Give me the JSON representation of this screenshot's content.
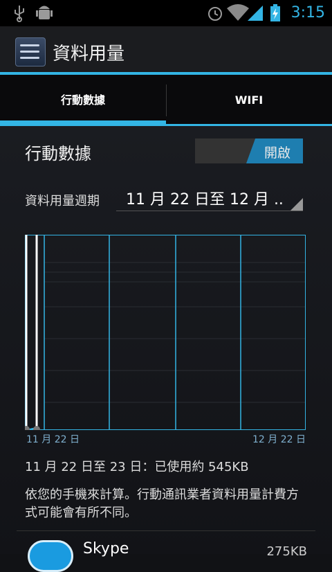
{
  "status_bar": {
    "time": "3:15",
    "icons": [
      "usb-icon",
      "android-debug-icon",
      "alarm-icon",
      "wifi-icon",
      "signal-icon",
      "battery-charging-icon"
    ]
  },
  "action_bar": {
    "title": "資料用量",
    "app_icon": "settings-sliders-icon"
  },
  "tabs": [
    {
      "label": "行動數據",
      "selected": true
    },
    {
      "label": "WIFI",
      "selected": false
    }
  ],
  "mobile_data": {
    "title": "行動數據",
    "toggle_label": "開啟",
    "enabled": true
  },
  "cycle": {
    "label": "資料用量週期",
    "value": "11 月 22 日至 12 月 .."
  },
  "chart_data": {
    "type": "line",
    "x_start_label": "11 月 22 日",
    "x_end_label": "12 月 22 日",
    "selection_start": "11 月 22 日",
    "selection_end": "11 月 23 日"
  },
  "usage_summary": "11 月 22 日至 23 日：已使用約 545KB",
  "note": "依您的手機來計算。行動通訊業者資料用量計費方式可能會有所不同。",
  "app_list": [
    {
      "name": "Skype",
      "size": "275KB",
      "icon": "skype-icon"
    }
  ],
  "colors": {
    "accent": "#33b5e5",
    "toggle_on": "#1e7eb0",
    "background": "#111215"
  }
}
